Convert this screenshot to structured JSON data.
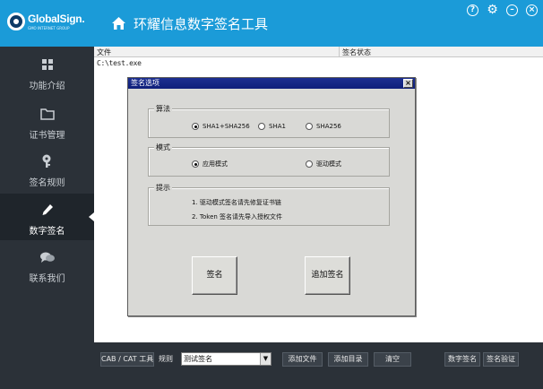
{
  "brand": {
    "name": "GlobalSign.",
    "tagline": "GMO INTERNET GROUP"
  },
  "header": {
    "title": "环耀信息数字签名工具",
    "icons": [
      "help-icon",
      "gear-icon",
      "minimize-icon",
      "close-icon"
    ],
    "help_glyph": "?",
    "min_glyph": "–",
    "close_glyph": "×",
    "gear_glyph": "⚙"
  },
  "sidebar": {
    "items": [
      {
        "label": "功能介绍",
        "icon": "grid-icon",
        "active": false
      },
      {
        "label": "证书管理",
        "icon": "folder-icon",
        "active": false
      },
      {
        "label": "签名规则",
        "icon": "key-icon",
        "active": false
      },
      {
        "label": "数字签名",
        "icon": "pen-icon",
        "active": true
      },
      {
        "label": "联系我们",
        "icon": "chat-icon",
        "active": false
      }
    ]
  },
  "file_list": {
    "columns": [
      "文件",
      "签名状态"
    ],
    "rows": [
      {
        "file": "C:\\test.exe",
        "status": ""
      }
    ]
  },
  "dialog": {
    "title": "签名选项",
    "close_glyph": "×",
    "algorithm": {
      "title": "算法",
      "options": [
        "SHA1+SHA256",
        "SHA1",
        "SHA256"
      ],
      "selected": "SHA1+SHA256"
    },
    "mode": {
      "title": "模式",
      "options": [
        "应用模式",
        "驱动模式"
      ],
      "selected": "应用模式"
    },
    "tips": {
      "title": "提示",
      "lines": [
        "1. 驱动模式签名请先修复证书链",
        "2. Token 签名请先导入授权文件"
      ]
    },
    "buttons": {
      "sign": "签名",
      "add_sign": "追加签名"
    }
  },
  "toolbar": {
    "cab_cat": "CAB / CAT 工具",
    "rule_label": "规则",
    "rule_value": "测试签名",
    "add_file": "添加文件",
    "add_dir": "添加目录",
    "clear": "清空",
    "digital_sign": "数字签名",
    "verify": "签名验证"
  },
  "colors": {
    "header": "#1b9bd8",
    "sidebar": "#2b3138",
    "dialog_title": "#1d2f91"
  }
}
